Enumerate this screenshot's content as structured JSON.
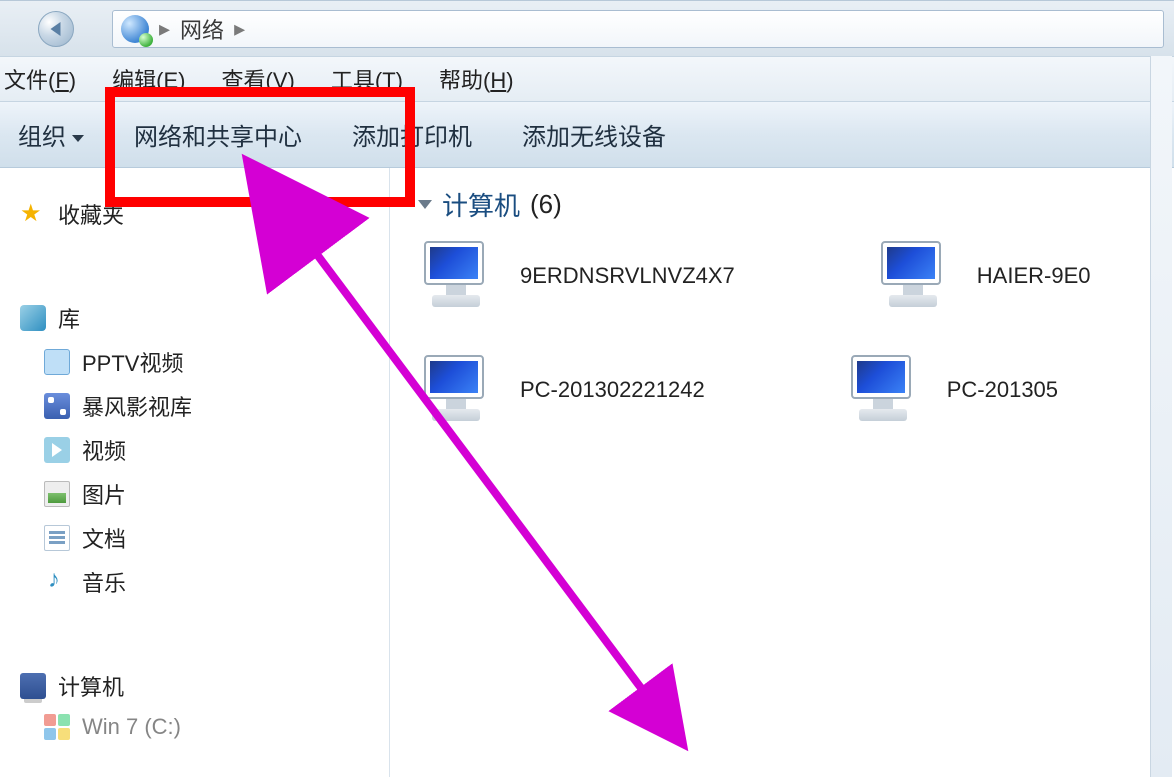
{
  "address_bar": {
    "location_label": "网络",
    "separator": "▸"
  },
  "menubar": {
    "file": {
      "label": "文件",
      "mnemonic": "F"
    },
    "edit": {
      "label": "编辑",
      "mnemonic": "E"
    },
    "view": {
      "label": "查看",
      "mnemonic": "V"
    },
    "tools": {
      "label": "工具",
      "mnemonic": "T"
    },
    "help": {
      "label": "帮助",
      "mnemonic": "H"
    }
  },
  "toolbar": {
    "organize": "组织",
    "network_center": "网络和共享中心",
    "add_printer": "添加打印机",
    "add_wireless": "添加无线设备"
  },
  "sidebar": {
    "favorites_label": "收藏夹",
    "libraries_label": "库",
    "lib_items": {
      "pptv": "PPTV视频",
      "baofeng": "暴风影视库",
      "videos": "视频",
      "pictures": "图片",
      "documents": "文档",
      "music": "音乐"
    },
    "computer_label": "计算机",
    "win7_label": "Win 7 (C:)"
  },
  "content": {
    "group_label": "计算机",
    "group_count": "(6)",
    "computers": {
      "c0": "9ERDNSRVLNVZ4X7",
      "c1": "HAIER-9E0",
      "c2": "PC-201302221242",
      "c3": "PC-201305"
    }
  },
  "annotation": {
    "highlight_color": "#ff0000",
    "arrow_color": "#d400d4"
  }
}
